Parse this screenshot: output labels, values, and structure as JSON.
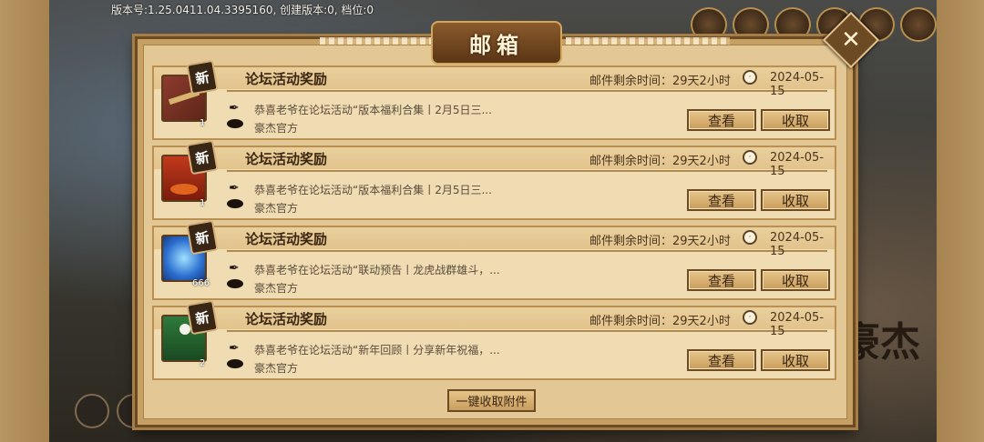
{
  "version_text": "版本号:1.25.0411.04.3395160,  创建版本:0, 档位:0",
  "logo_text": "豪杰",
  "mailbox": {
    "title": "邮箱",
    "close_icon": "close-icon",
    "claim_all_label": "一键收取附件",
    "mails": [
      {
        "subject": "论坛活动奖励",
        "remaining": "邮件剩余时间：29天2小时",
        "date": "2024-05-15",
        "new_tag": "新",
        "quantity": "1",
        "description": "恭喜老爷在论坛活动“版本福利合集丨2月5日三...",
        "sender": "豪杰官方",
        "view_label": "查看",
        "claim_label": "收取",
        "item_icon": "scroll-item-icon"
      },
      {
        "subject": "论坛活动奖励",
        "remaining": "邮件剩余时间：29天2小时",
        "date": "2024-05-15",
        "new_tag": "新",
        "quantity": "1",
        "description": "恭喜老爷在论坛活动“版本福利合集丨2月5日三...",
        "sender": "豪杰官方",
        "view_label": "查看",
        "claim_label": "收取",
        "item_icon": "red-chest-item-icon"
      },
      {
        "subject": "论坛活动奖励",
        "remaining": "邮件剩余时间：29天2小时",
        "date": "2024-05-15",
        "new_tag": "新",
        "quantity": "666",
        "description": "恭喜老爷在论坛活动“联动预告丨龙虎战群雄斗，...",
        "sender": "豪杰官方",
        "view_label": "查看",
        "claim_label": "收取",
        "item_icon": "diamond-item-icon"
      },
      {
        "subject": "论坛活动奖励",
        "remaining": "邮件剩余时间：29天2小时",
        "date": "2024-05-15",
        "new_tag": "新",
        "quantity": "2",
        "description": "恭喜老爷在论坛活动“新年回顾丨分享新年祝福，...",
        "sender": "豪杰官方",
        "view_label": "查看",
        "claim_label": "收取",
        "item_icon": "green-gift-item-icon"
      }
    ]
  },
  "colors": {
    "panel": "#c7a064",
    "button": "#c99e5d",
    "text_dark": "#3b2611"
  }
}
